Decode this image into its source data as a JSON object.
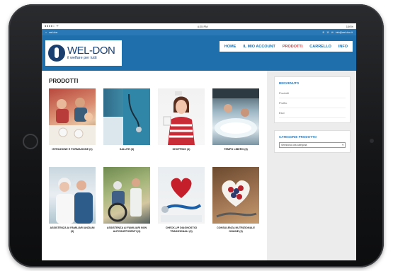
{
  "status": {
    "signal": "●●●●○ ᯤ",
    "time": "4:25 PM",
    "battery": "100%"
  },
  "topbar": {
    "left": "wel-don",
    "phone": "11",
    "email": "info@wel-don.it"
  },
  "logo": {
    "name": "WEL-DON",
    "tagline": "il welfare per tutti"
  },
  "nav": [
    {
      "label": "HOME"
    },
    {
      "label": "IL MIO ACCOUNT"
    },
    {
      "label": "PRODOTTI"
    },
    {
      "label": "CARRELLO"
    },
    {
      "label": "INFO"
    }
  ],
  "main": {
    "title": "PRODOTTI",
    "categories": [
      {
        "label": "ISTRUZIONE E FORMAZIONE (3)",
        "icon": "family-meal-photo"
      },
      {
        "label": "SALUTE (8)",
        "icon": "doctor-stethoscope-photo"
      },
      {
        "label": "SHOPPING (4)",
        "icon": "woman-shopping-photo"
      },
      {
        "label": "TEMPO LIBERO (8)",
        "icon": "spa-relax-photo"
      },
      {
        "label": "ASSISTENZA AI FAMILIARI ANZIANI (3)",
        "icon": "elderly-care-photo"
      },
      {
        "label": "ASSISTENZA AI FAMILIARI NON AUTOSUFFICIENTI (3)",
        "icon": "wheelchair-photo"
      },
      {
        "label": "CHECK-UP DIAGNOSTICI TRADIZIONALI (3)",
        "icon": "heart-stethoscope-photo"
      },
      {
        "label": "CONSULENZA NUTRIZIONALE ONLINE (3)",
        "icon": "berries-heart-bowl-photo"
      }
    ]
  },
  "sidebar": {
    "welcome_title": "BENVENUTO",
    "links": [
      {
        "label": "Prodotti"
      },
      {
        "label": "Profilo"
      },
      {
        "label": "Esci"
      }
    ],
    "cat_title": "CATEGORIE PRODOTTO",
    "select_value": "Seleziona una categoria"
  },
  "colors": {
    "brand": "#1f6fad",
    "accent": "#e0393e",
    "topbar": "#2a78b6"
  }
}
